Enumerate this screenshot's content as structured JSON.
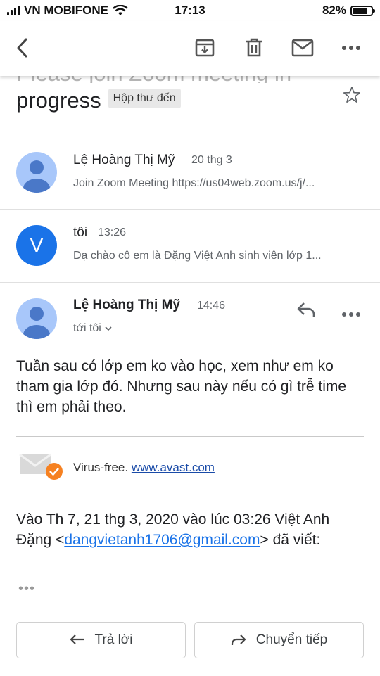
{
  "status_bar": {
    "carrier": "VN MOBIFONE",
    "time": "17:13",
    "battery_percent": "82%",
    "battery_level": 0.82
  },
  "subject": {
    "line1": "Please join Zoom meeting in",
    "line2": "progress",
    "label_badge": "Hộp thư đến"
  },
  "messages": [
    {
      "sender": "Lệ Hoàng Thị Mỹ",
      "date": "20 thg 3",
      "snippet": "Join Zoom Meeting https://us04web.zoom.us/j/..."
    },
    {
      "avatar_letter": "V",
      "sender": "tôi",
      "date": "13:26",
      "snippet": "Dạ chào cô em là Đặng Việt Anh sinh viên lớp 1..."
    },
    {
      "sender": "Lệ Hoàng Thị Mỹ",
      "date": "14:46",
      "recipient": "tới tôi",
      "body": "Tuần sau có lớp em ko vào học, xem như em ko tham gia lớp đó. Nhưng sau này nếu có gì trễ time thì em phải theo.",
      "virus_text": "Virus-free.",
      "virus_link": "www.avast.com",
      "quote_prefix": "Vào Th 7, 21 thg 3, 2020 vào lúc 03:26 Việt Anh Đặng <",
      "quote_email": "dangvietanh1706@gmail.com",
      "quote_suffix": "> đã viết:",
      "ellipsis": "•••"
    }
  ],
  "actions": {
    "reply": "Trả lời",
    "forward": "Chuyển tiếp"
  },
  "icons": [
    "back-icon",
    "archive-icon",
    "delete-icon",
    "mail-icon",
    "more-icon",
    "star-icon",
    "reply-icon",
    "forward-icon",
    "chevron-down-icon",
    "avast-mail-icon"
  ],
  "colors": {
    "avatar_person": "#a8c7fa",
    "avatar_person_dark": "#4a78c8",
    "avatar_v": "#1a73e8",
    "link": "#1a73e8",
    "avast_badge": "#f68121"
  }
}
